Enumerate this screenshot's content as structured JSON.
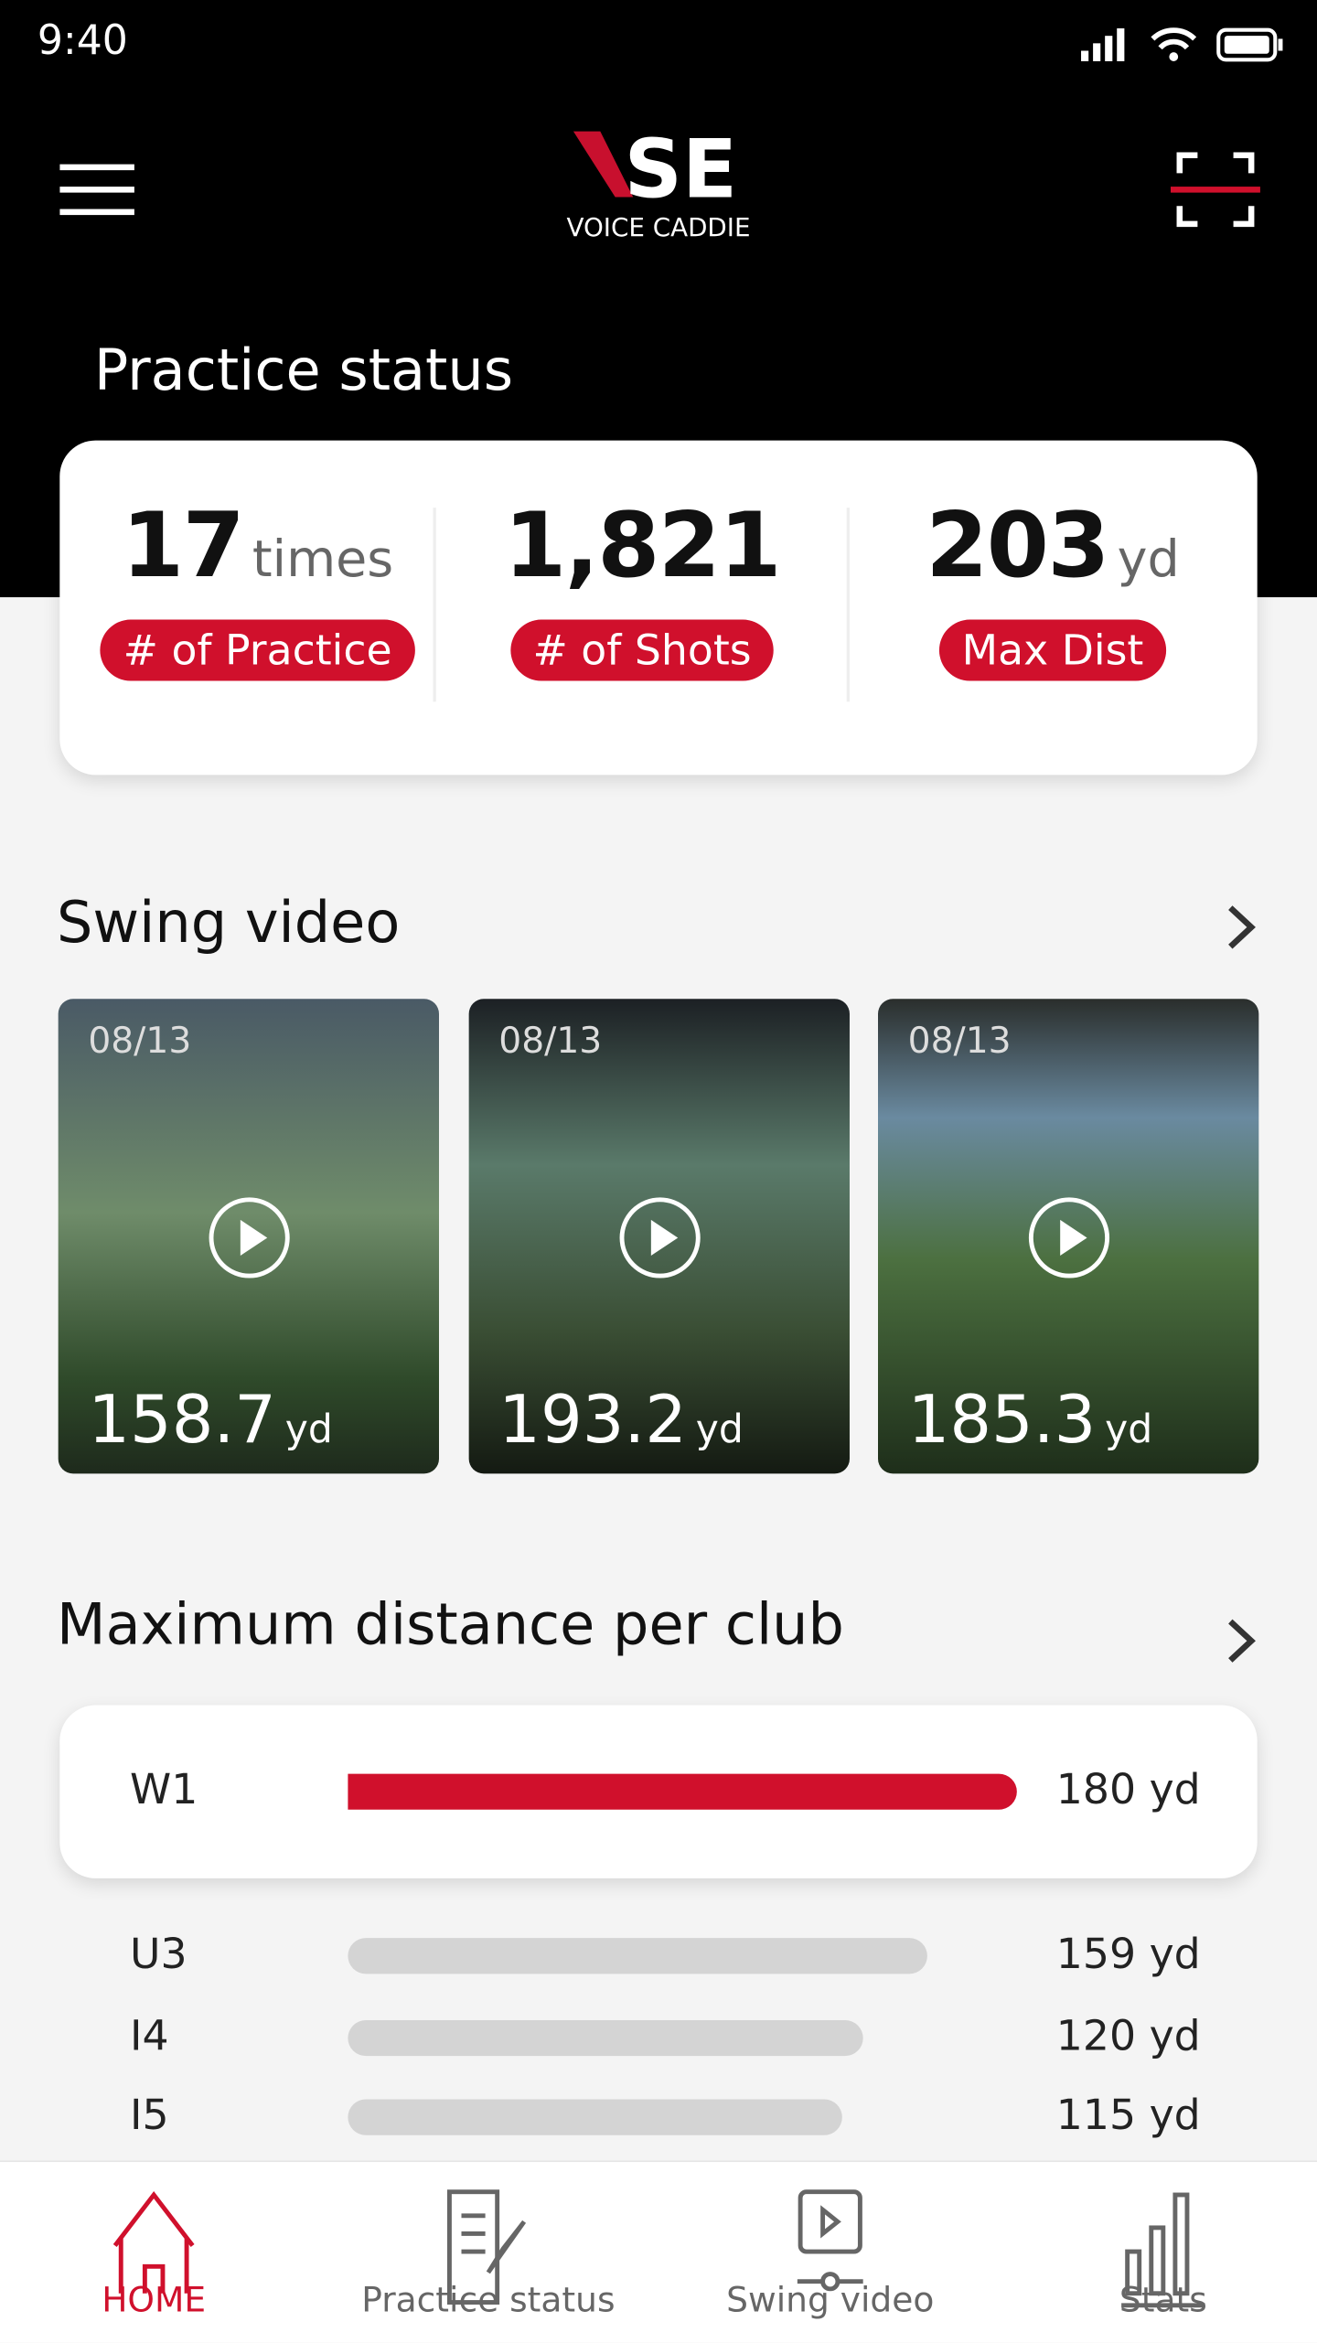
{
  "status_bar": {
    "time": "9:40"
  },
  "header": {
    "logo_text": "VSE",
    "logo_sub": "VOICE CADDIE",
    "menu_icon": "hamburger-icon",
    "scan_icon": "scan-icon"
  },
  "practice_status": {
    "title": "Practice status",
    "stats": [
      {
        "value": "17",
        "unit": "times",
        "label": "# of Practice"
      },
      {
        "value": "1,821",
        "unit": "",
        "label": "# of Shots"
      },
      {
        "value": "203",
        "unit": "yd",
        "label": "Max Dist"
      }
    ]
  },
  "swing_video": {
    "title": "Swing video",
    "videos": [
      {
        "date": "08/13",
        "distance": "158.7",
        "unit": "yd"
      },
      {
        "date": "08/13",
        "distance": "193.2",
        "unit": "yd"
      },
      {
        "date": "08/13",
        "distance": "185.3",
        "unit": "yd"
      }
    ]
  },
  "max_distance": {
    "title": "Maximum distance per club",
    "clubs": [
      {
        "club": "W1",
        "value": "180 yd",
        "yards": 180
      },
      {
        "club": "U3",
        "value": "159 yd",
        "yards": 159
      },
      {
        "club": "I4",
        "value": "120 yd",
        "yards": 120
      },
      {
        "club": "I5",
        "value": "115 yd",
        "yards": 115
      }
    ]
  },
  "colors": {
    "accent": "#d0102c",
    "bar_inactive": "#d4d4d4"
  },
  "nav": {
    "items": [
      {
        "label": "HOME",
        "icon": "home-icon",
        "active": true
      },
      {
        "label": "Practice status",
        "icon": "document-edit-icon"
      },
      {
        "label": "Swing video",
        "icon": "video-icon"
      },
      {
        "label": "Stats",
        "icon": "bar-chart-icon"
      }
    ]
  }
}
